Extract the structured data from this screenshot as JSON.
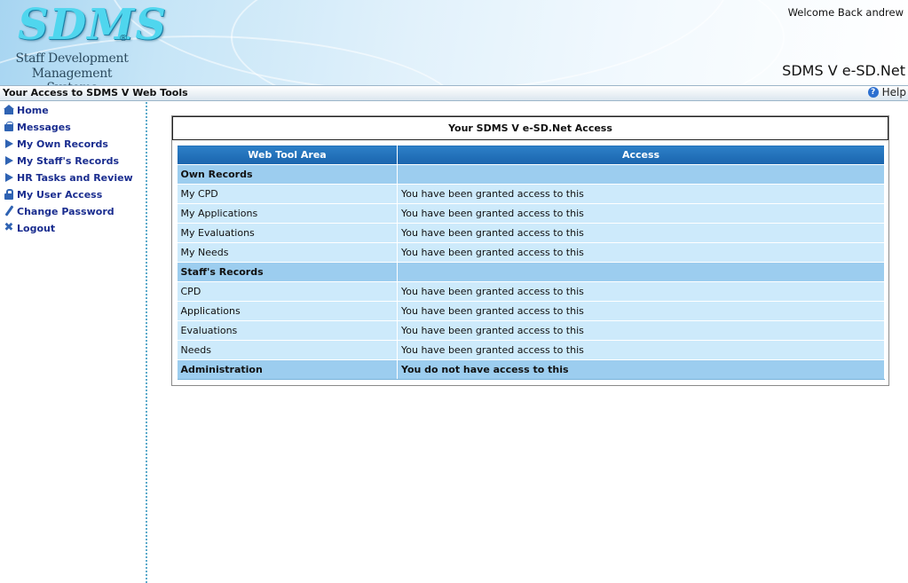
{
  "header": {
    "logo_mark": "SDMS",
    "logo_reg": "®",
    "logo_line1": "Staff Development",
    "logo_line2": "Management Systems",
    "welcome": "Welcome Back andrew",
    "product": "SDMS V e-SD.Net"
  },
  "titlebar": {
    "title": "Your Access to SDMS V Web Tools",
    "help_label": "Help",
    "help_icon": "question-icon"
  },
  "sidebar": {
    "items": [
      {
        "label": "Home",
        "icon": "home-icon"
      },
      {
        "label": "Messages",
        "icon": "messages-icon"
      },
      {
        "label": "My Own Records",
        "icon": "play-icon"
      },
      {
        "label": "My Staff's Records",
        "icon": "play-icon"
      },
      {
        "label": "HR Tasks and Review",
        "icon": "play-icon"
      },
      {
        "label": "My User Access",
        "icon": "lock-icon"
      },
      {
        "label": "Change Password",
        "icon": "pen-icon"
      },
      {
        "label": "Logout",
        "icon": "x-icon"
      }
    ]
  },
  "panel": {
    "title": "Your SDMS V e-SD.Net Access",
    "columns": [
      "Web Tool Area",
      "Access"
    ],
    "rows": [
      {
        "type": "section",
        "area": "Own Records",
        "access": ""
      },
      {
        "type": "item",
        "area": "My CPD",
        "access": "You have been granted access to this"
      },
      {
        "type": "item",
        "area": "My Applications",
        "access": "You have been granted access to this"
      },
      {
        "type": "item",
        "area": "My Evaluations",
        "access": "You have been granted access to this"
      },
      {
        "type": "item",
        "area": "My Needs",
        "access": "You have been granted access to this"
      },
      {
        "type": "section",
        "area": "Staff's Records",
        "access": ""
      },
      {
        "type": "item",
        "area": "CPD",
        "access": "You have been granted access to this"
      },
      {
        "type": "item",
        "area": "Applications",
        "access": "You have been granted access to this"
      },
      {
        "type": "item",
        "area": "Evaluations",
        "access": "You have been granted access to this"
      },
      {
        "type": "item",
        "area": "Needs",
        "access": "You have been granted access to this"
      },
      {
        "type": "deny",
        "area": "Administration",
        "access": "You do not have access to this"
      }
    ]
  },
  "colors": {
    "header_blue": "#2d80c8",
    "section_row": "#9ccdef",
    "item_row": "#cdeafb",
    "nav_text": "#1a2d8f",
    "logo_cyan": "#4fd6ee"
  }
}
